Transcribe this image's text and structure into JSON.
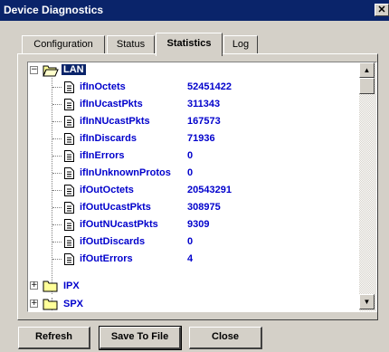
{
  "window": {
    "title": "Device Diagnostics",
    "close_glyph": "✕"
  },
  "tabs": [
    {
      "label": "Configuration"
    },
    {
      "label": "Status"
    },
    {
      "label": "Statistics"
    },
    {
      "label": "Log"
    }
  ],
  "active_tab": "Statistics",
  "tree": {
    "root": {
      "label": "LAN",
      "expanded": true,
      "expander": "−"
    },
    "items": [
      {
        "label": "ifInOctets",
        "value": "52451422"
      },
      {
        "label": "ifInUcastPkts",
        "value": "311343"
      },
      {
        "label": "ifInNUcastPkts",
        "value": "167573"
      },
      {
        "label": "ifInDiscards",
        "value": "71936"
      },
      {
        "label": "ifInErrors",
        "value": "0"
      },
      {
        "label": "ifInUnknownProtos",
        "value": "0"
      },
      {
        "label": "ifOutOctets",
        "value": "20543291"
      },
      {
        "label": "ifOutUcastPkts",
        "value": "308975"
      },
      {
        "label": "ifOutNUcastPkts",
        "value": "9309"
      },
      {
        "label": "ifOutDiscards",
        "value": "0"
      },
      {
        "label": "ifOutErrors",
        "value": "4"
      }
    ],
    "siblings": [
      {
        "label": "IPX",
        "expander": "+"
      },
      {
        "label": "SPX",
        "expander": "+"
      }
    ]
  },
  "scrollbar": {
    "up_glyph": "▲",
    "down_glyph": "▼"
  },
  "buttons": {
    "refresh": "Refresh",
    "save_to_file": "Save To File",
    "close": "Close"
  },
  "colors": {
    "title_bg": "#0a246a",
    "label_blue": "#0000cc",
    "face": "#d4d0c8"
  }
}
